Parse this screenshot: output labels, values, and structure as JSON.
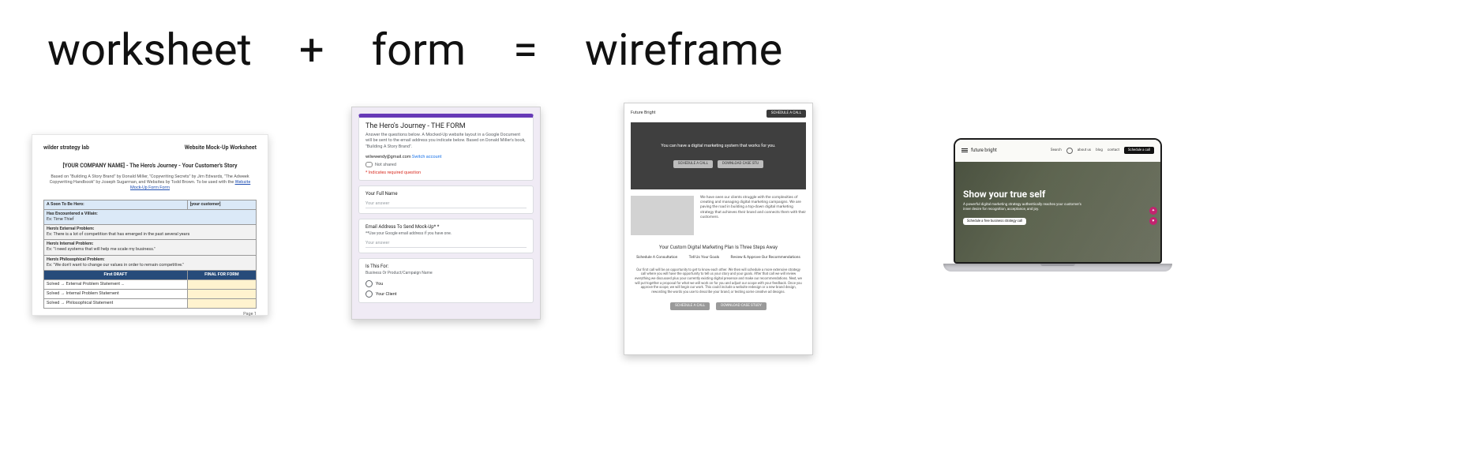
{
  "equation": {
    "word1": "worksheet",
    "plus": "+",
    "word2": "form",
    "equals": "=",
    "word3": "wireframe"
  },
  "worksheet": {
    "brand": "wilder strategy lab",
    "docname": "Website Mock-Up Worksheet",
    "title": "[YOUR COMPANY NAME]  -  The Hero's Journey  -  Your Customer's Story",
    "subtitle_prefix": "Based on \"Building A Story Brand\" by Donald Miller, \"Copywriting Secrets\" by Jim Edwards,  \"The Adweek Copywriting Handbook\" by Joseph Sugarman, and Websites by Todd Brown.  To be used with the ",
    "subtitle_link": "Website Mock-Up Form Form",
    "row1_left": "A Soon To Be Hero:",
    "row1_right": "[your customer]",
    "row2": "Has Encountered a Villain:",
    "row2b": "Ex: Time Thief",
    "row3_label": "Hero's External Problem:",
    "row3_text": "Ex: There is a lot of competition that has emerged in the past several years",
    "row4_label": "Hero's Internal Problem:",
    "row4_text": "Ex: \"I need systems that will help me scale my business.\"",
    "row5_label": "Hero's Philosophical Problem:",
    "row5_text": "Ex: \"We don't want to change our values in order to remain competitive.\"",
    "col_draft": "First DRAFT",
    "col_final": "FINAL FOR FORM",
    "result1": "Solved → External Problem Statement …",
    "result2": "Solved → Internal Problem Statement",
    "result3": "Solved → Philosophical Statement",
    "page": "Page 1"
  },
  "form": {
    "title": "The Hero's Journey - THE FORM",
    "desc": "Answer the questions below.  A Mocked-Up website layout in a Google Document will be sent to the email address you indicate below.  Based on Donald Miller's book, \"Building A Story Brand\".",
    "email": "wilwwendy@gmail.com",
    "switch": "Switch account",
    "not_shared": "Not shared",
    "required": "* Indicates required question",
    "q1_label": "Your Full Name",
    "q1_placeholder": "Your answer",
    "q2_label": "Email Address To Send Mock-Up* *",
    "q2_sub": "**Use your Google email address if you have one.",
    "q2_placeholder": "Your answer",
    "q3_label": "Is This For:",
    "q3_sub": "Business Or Product/Campaign Name",
    "q3_opt1": "You",
    "q3_opt2": "Your Client"
  },
  "wireframe": {
    "brand": "Future Bright",
    "cta_schedule": "SCHEDULE A CALL",
    "hero_line": "You can have a digital marketing system that works for you.",
    "cta_download": "DOWNLOAD CASE STU",
    "side_text": "We have seen our clients struggle with the complexities of creating and managing digital marketing campaigns. We are paving the road in building a top-down digital marketing strategy that achieves their brand and connects them with their customers.",
    "section_title": "Your Custom Digital Marketing Plan Is Three Steps Away",
    "step1": "Schedule A Consultation",
    "step2": "Tell Us Your Goals",
    "step3": "Review & Approve Our Recommendations",
    "long_para": "Our first call will be an opportunity to get to know each other.  We then will schedule a more extensive strategy call where you will have the opportunity to tell us your story and your goals.  After that call we will review everything we discussed plus your currently existing digital presence and make our recommendations.  Next, we will put together a proposal for what we will work on for you and adjust our scope with your feedback.  Once you approve the scope, we will begin our work.  This could include a website redesign or a new brand design, rewording the words you use to describe your brand, or testing some creative ad designs.",
    "cta_bottom1": "SCHEDULE A CALL",
    "cta_bottom2": "DOWNLOAD CASE STUDY"
  },
  "site": {
    "brand": "future bright",
    "nav_search": "Search",
    "nav_about": "about us",
    "nav_blog": "blog",
    "nav_contact": "contact",
    "nav_cta": "Schedule a call",
    "hero_title": "Show your true self",
    "hero_sub": "A powerful digital marketing strategy authentically reaches your customer's inner desire for recognition, acceptance, and joy.",
    "hero_cta": "Schedule a free business strategy call"
  }
}
